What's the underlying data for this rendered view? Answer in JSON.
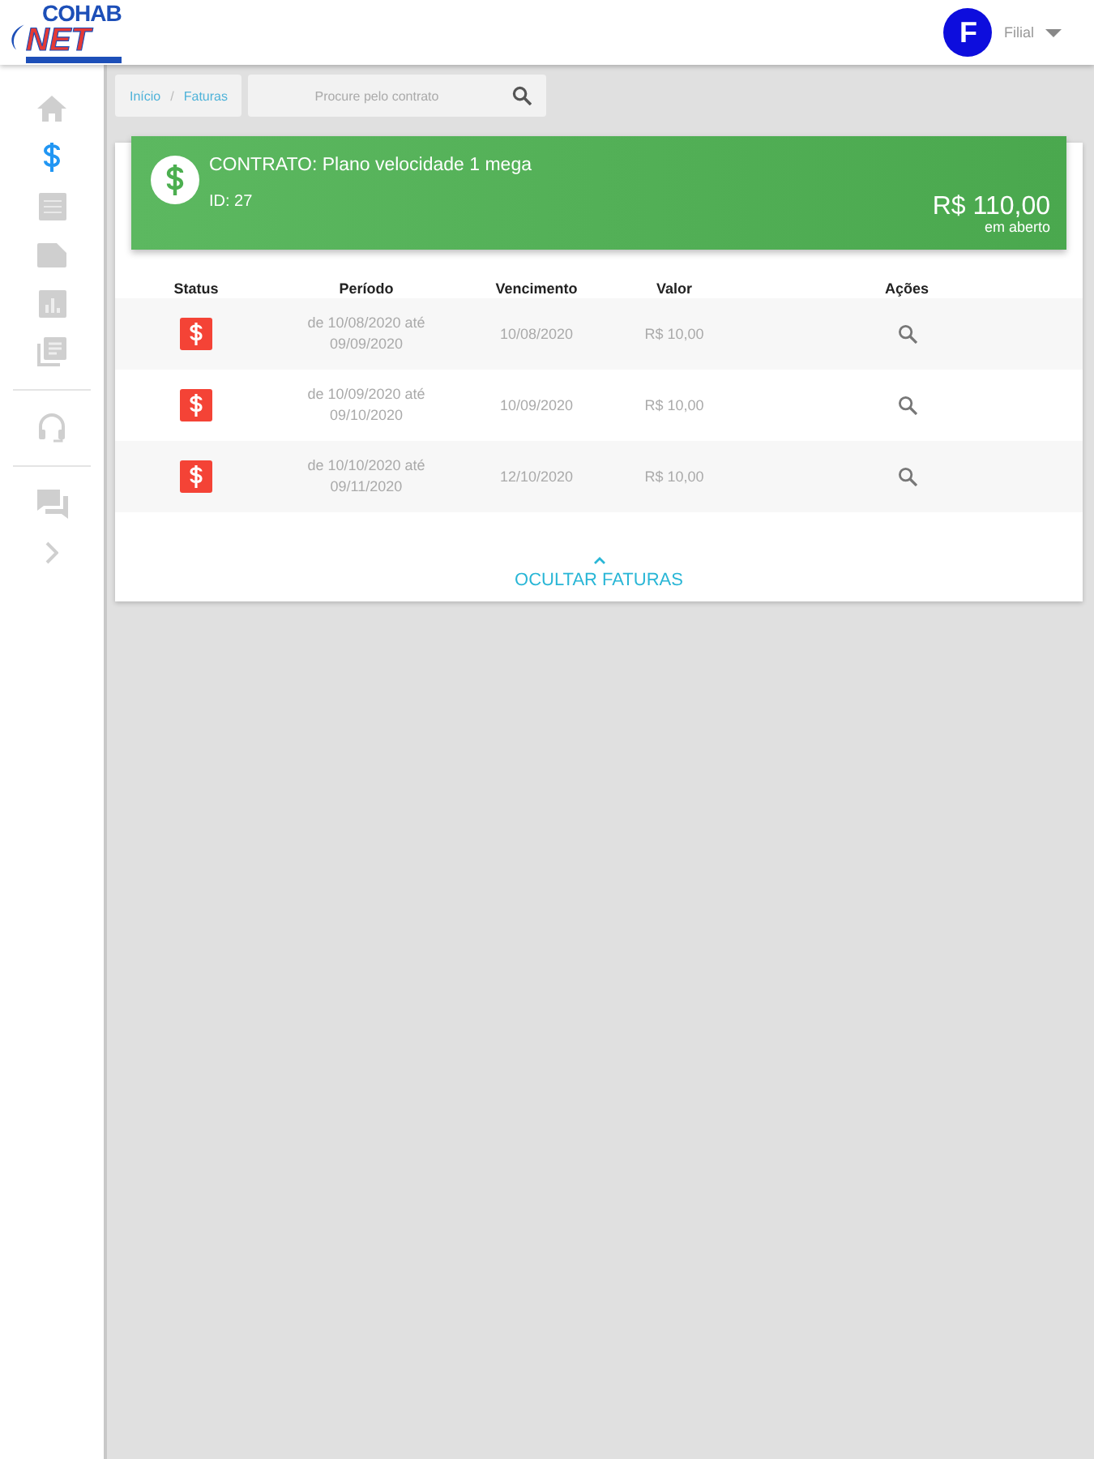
{
  "header": {
    "logo_top": "COHAB",
    "logo_bottom": "NET",
    "avatar_letter": "F",
    "user_name": "Filial"
  },
  "sidebar": {
    "sections": [
      {
        "items": [
          {
            "kind": "home",
            "selected": false
          },
          {
            "kind": "dollar",
            "selected": true
          },
          {
            "kind": "table",
            "selected": false
          },
          {
            "kind": "label",
            "selected": false
          },
          {
            "kind": "chart",
            "selected": false
          },
          {
            "kind": "list",
            "selected": false
          }
        ]
      },
      {
        "items": [
          {
            "kind": "headset",
            "selected": false
          }
        ]
      },
      {
        "items": [
          {
            "kind": "chat",
            "selected": false
          },
          {
            "kind": "chevron",
            "selected": false
          }
        ]
      }
    ]
  },
  "breadcrumb": {
    "separator": "/",
    "items": [
      "Início",
      "Faturas"
    ]
  },
  "search": {
    "placeholder": "Procure pelo contrato"
  },
  "contract": {
    "title": "CONTRATO: Plano velocidade 1 mega",
    "id": "ID: 27",
    "amount": "R$ 110,00",
    "amount_note": "em aberto"
  },
  "table": {
    "columns": [
      "Status",
      "Período",
      "Vencimento",
      "Valor",
      "Ações"
    ],
    "rows": [
      {
        "period": "de 10/08/2020 até 09/09/2020",
        "due": "10/08/2020",
        "value": "R$ 10,00"
      },
      {
        "period": "de 10/09/2020 até 09/10/2020",
        "due": "10/09/2020",
        "value": "R$ 10,00"
      },
      {
        "period": "de 10/10/2020 até 09/11/2020",
        "due": "12/10/2020",
        "value": "R$ 10,00"
      }
    ]
  },
  "toggle": {
    "label": "OCULTAR FATURAS",
    "expanded": true
  }
}
